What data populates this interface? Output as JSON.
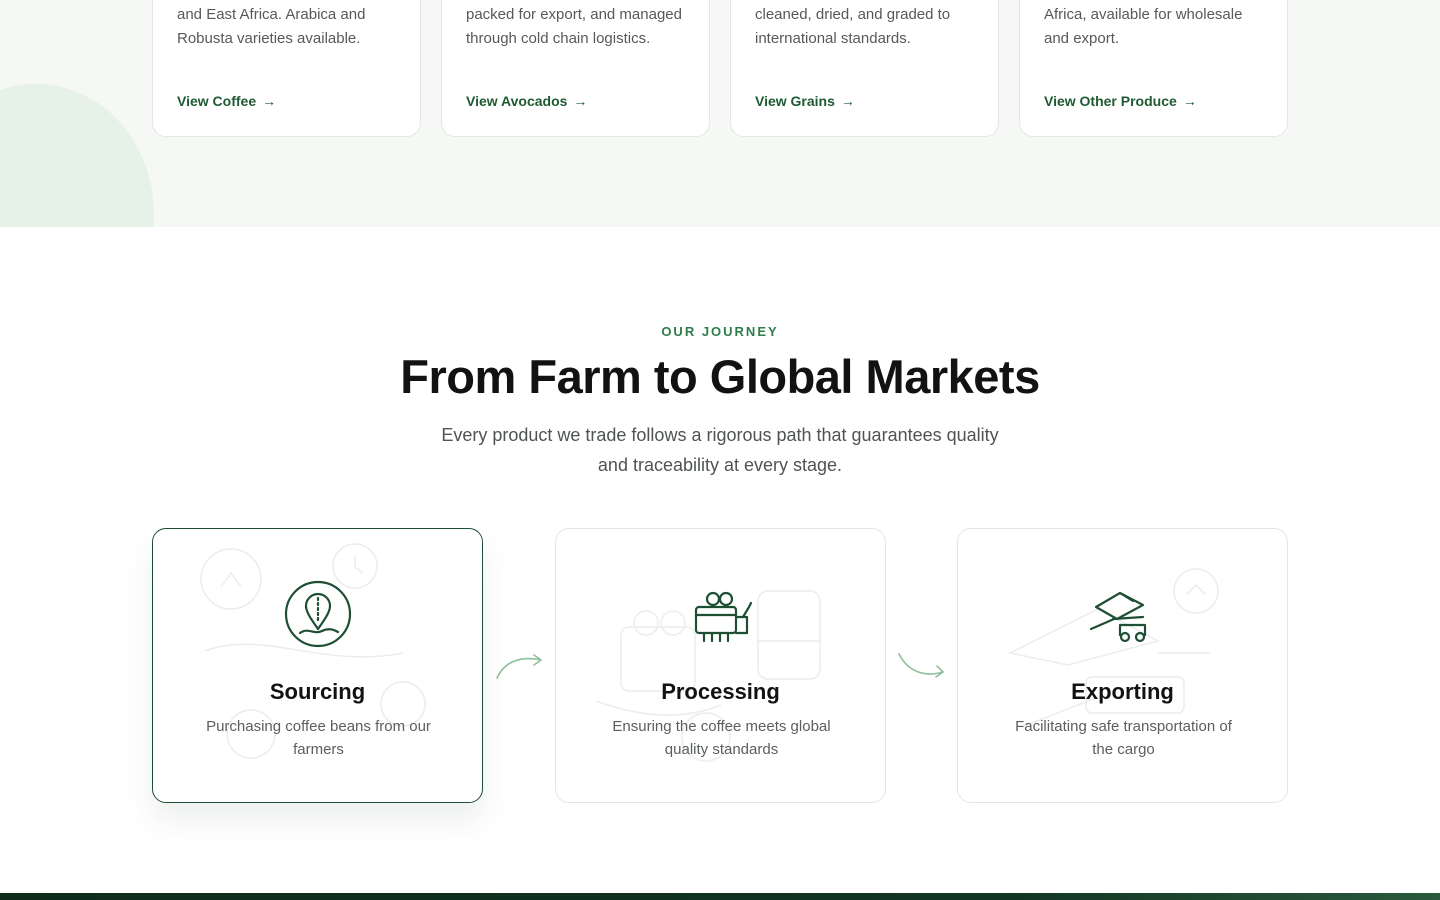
{
  "products": [
    {
      "desc": "and East Africa. Arabica and Robusta varieties available.",
      "link": "View Coffee",
      "arrow": "→"
    },
    {
      "desc": "packed for export, and managed through cold chain logistics.",
      "link": "View Avocados",
      "arrow": "→"
    },
    {
      "desc": "cleaned, dried, and graded to international standards.",
      "link": "View Grains",
      "arrow": "→"
    },
    {
      "desc": "Africa, available for wholesale and export.",
      "link": "View Other Produce",
      "arrow": "→"
    }
  ],
  "journey": {
    "eyebrow": "OUR JOURNEY",
    "headline": "From Farm to Global Markets",
    "subtext": "Every product we trade follows a rigorous path that guarantees quality and traceability at every stage.",
    "steps": [
      {
        "icon": "location-pin-icon",
        "title": "Sourcing",
        "desc": "Purchasing coffee beans from our farmers",
        "active": true
      },
      {
        "icon": "processing-machine-icon",
        "title": "Processing",
        "desc": "Ensuring the coffee meets global quality standards",
        "active": false
      },
      {
        "icon": "cargo-truck-icon",
        "title": "Exporting",
        "desc": "Facilitating safe transportation of the cargo",
        "active": false
      }
    ]
  },
  "colors": {
    "accent_green": "#2f7d4a",
    "dark_green": "#1f4f33",
    "link_green": "#1f5a33",
    "band_bg": "#f6f8f6",
    "blob": "#e6f2e7",
    "footer": "#0d2a1b"
  }
}
